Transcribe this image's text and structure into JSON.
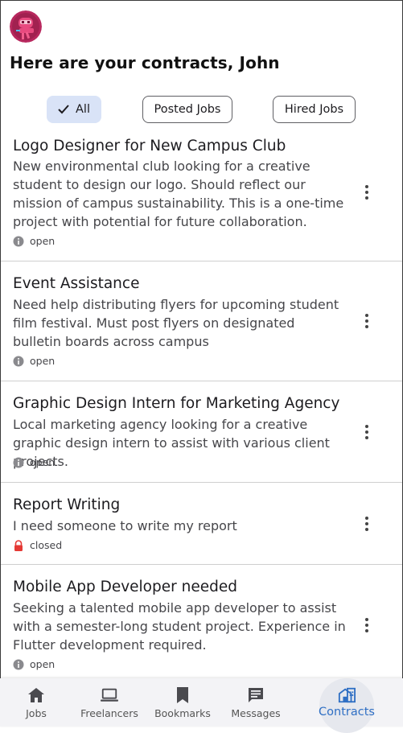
{
  "header": {
    "title": "Here are your contracts, John"
  },
  "filters": [
    {
      "label": "All",
      "selected": true
    },
    {
      "label": "Posted Jobs",
      "selected": false
    },
    {
      "label": "Hired Jobs",
      "selected": false
    }
  ],
  "contracts": [
    {
      "title": "Logo Designer for New Campus Club",
      "description": "New environmental club looking for a creative student to design our logo. Should reflect our mission of campus sustainability. This is a one-time project with potential for future collaboration.",
      "status": "open",
      "status_icon": "info-icon"
    },
    {
      "title": "Event Assistance",
      "description": "Need help distributing flyers for upcoming student film festival. Must post flyers on designated bulletin boards across campus",
      "status": "open",
      "status_icon": "info-icon"
    },
    {
      "title": "Graphic Design Intern for Marketing Agency",
      "description": "Local marketing agency looking for a creative graphic design intern to assist with various client projects.",
      "status": "open",
      "status_icon": "info-icon"
    },
    {
      "title": "Report Writing",
      "description": "I need someone to write my report",
      "status": "closed",
      "status_icon": "lock-icon"
    },
    {
      "title": "Mobile App Developer needed",
      "description": "Seeking a talented mobile app developer to assist with a semester-long student project. Experience in Flutter development required.",
      "status": "open",
      "status_icon": "info-icon"
    }
  ],
  "nav": [
    {
      "label": "Jobs",
      "icon": "home-icon"
    },
    {
      "label": "Freelancers",
      "icon": "laptop-icon"
    },
    {
      "label": "Bookmarks",
      "icon": "bookmark-icon"
    },
    {
      "label": "Messages",
      "icon": "message-icon"
    },
    {
      "label": "Contracts",
      "icon": "contracts-icon",
      "active": true
    }
  ],
  "colors": {
    "accent": "#2f6fc4",
    "chip_selected": "#d9e3f7",
    "avatar": "#c2185b",
    "closed": "#e53935"
  }
}
